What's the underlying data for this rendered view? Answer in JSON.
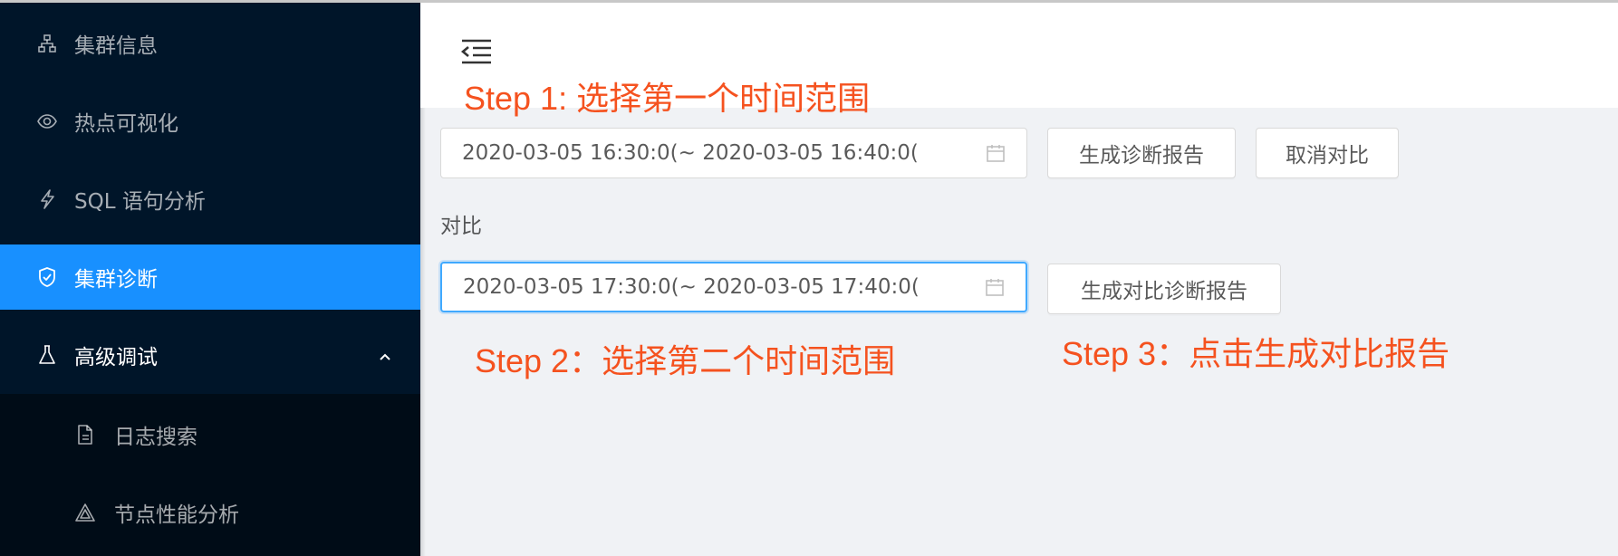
{
  "sidebar": {
    "items": [
      {
        "label": "集群信息",
        "icon": "cluster-icon"
      },
      {
        "label": "热点可视化",
        "icon": "eye-icon"
      },
      {
        "label": "SQL 语句分析",
        "icon": "lightning-icon"
      },
      {
        "label": "集群诊断",
        "icon": "shield-check-icon",
        "active": true
      },
      {
        "label": "高级调试",
        "icon": "flask-icon",
        "expanded": true
      }
    ],
    "subitems": [
      {
        "label": "日志搜索",
        "icon": "file-text-icon"
      },
      {
        "label": "节点性能分析",
        "icon": "triangle-icon"
      }
    ],
    "colors": {
      "background": "#001529",
      "submenu": "#000c17",
      "active": "#1890ff"
    }
  },
  "header": {
    "fold_icon": "menu-fold-icon"
  },
  "annotations": {
    "step1": "Step 1: 选择第一个时间范围",
    "step2": "Step 2：选择第二个时间范围",
    "step3": "Step 3：点击生成对比报告",
    "color": "#f5521f"
  },
  "main": {
    "range1": {
      "start": "2020-03-05 16:30:00",
      "end": "2020-03-05 16:40:00",
      "display": "2020-03-05 16:30:0(~ 2020-03-05 16:40:0("
    },
    "generate_button": "生成诊断报告",
    "cancel_compare_button": "取消对比",
    "compare_label": "对比",
    "range2": {
      "start": "2020-03-05 17:30:00",
      "end": "2020-03-05 17:40:00",
      "display": "2020-03-05 17:30:0(~ 2020-03-05 17:40:0("
    },
    "generate_compare_button": "生成对比诊断报告"
  }
}
